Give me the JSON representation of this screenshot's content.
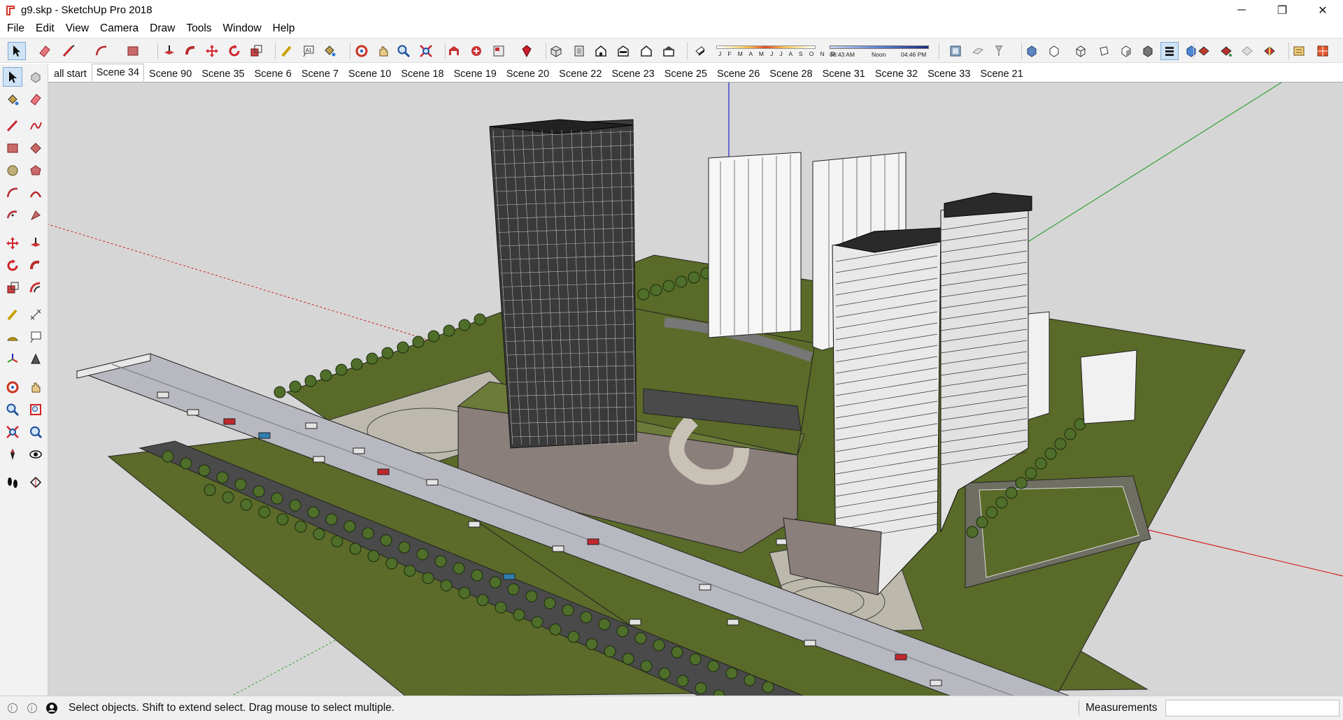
{
  "window": {
    "title": "g9.skp - SketchUp Pro 2018",
    "controls": {
      "minimize": "─",
      "maximize": "❐",
      "close": "✕"
    }
  },
  "menu": [
    "File",
    "Edit",
    "View",
    "Camera",
    "Draw",
    "Tools",
    "Window",
    "Help"
  ],
  "toolbar": {
    "icons": [
      "select-icon",
      "eraser-icon",
      "line-icon",
      "arc-icon",
      "rectangle-icon",
      "push-pull-icon",
      "follow-me-icon",
      "move-icon",
      "rotate-icon",
      "scale-icon",
      "tape-measure-icon",
      "text-icon",
      "paint-bucket-icon",
      "orbit-icon",
      "pan-icon",
      "zoom-icon",
      "zoom-extents-icon",
      "warehouse-icon",
      "extension-warehouse-icon",
      "layout-icon",
      "ruby-icon",
      "iso-view-icon",
      "top-view-icon",
      "front-view-icon",
      "right-view-icon",
      "back-view-icon",
      "left-view-icon",
      "shadows-toggle-icon"
    ],
    "shadow": {
      "months": "J F M A M J J A S O N D",
      "time_start": "06:43 AM",
      "time_mid": "Noon",
      "time_end": "04:46 PM"
    },
    "right_icons": [
      "model-info-icon",
      "section-plane-icon",
      "section-display-icon",
      "xray-style-icon",
      "backedges-style-icon",
      "wireframe-style-icon",
      "hidden-line-style-icon",
      "shaded-style-icon",
      "shaded-textures-icon",
      "monochrome-style-icon",
      "match-photo-icon",
      "components-icon",
      "materials-icon",
      "styles-icon",
      "layers-icon",
      "scenes-icon"
    ]
  },
  "scenes": {
    "active": "Scene 34",
    "tabs": [
      "all start",
      "Scene 34",
      "Scene 90",
      "Scene 35",
      "Scene 6",
      "Scene 7",
      "Scene 10",
      "Scene 18",
      "Scene 19",
      "Scene 20",
      "Scene 22",
      "Scene 23",
      "Scene 25",
      "Scene 26",
      "Scene 28",
      "Scene 31",
      "Scene 32",
      "Scene 33",
      "Scene 21"
    ]
  },
  "left_tools": [
    [
      "select-icon",
      "make-component-icon"
    ],
    [
      "paint-bucket-icon",
      "eraser-icon"
    ],
    [
      "line-icon",
      "freehand-icon"
    ],
    [
      "rectangle-icon",
      "rotated-rectangle-icon"
    ],
    [
      "circle-icon",
      "polygon-icon"
    ],
    [
      "arc-icon",
      "two-point-arc-icon"
    ],
    [
      "three-point-arc-icon",
      "pie-icon"
    ],
    [
      "move-icon",
      "push-pull-icon"
    ],
    [
      "rotate-icon",
      "follow-me-icon"
    ],
    [
      "scale-icon",
      "offset-icon"
    ],
    [
      "tape-measure-icon",
      "dimension-icon"
    ],
    [
      "protractor-icon",
      "text-icon"
    ],
    [
      "axes-icon",
      "3d-text-icon"
    ],
    [
      "orbit-icon",
      "pan-icon"
    ],
    [
      "zoom-icon",
      "zoom-window-icon"
    ],
    [
      "zoom-extents-icon",
      "previous-view-icon"
    ],
    [
      "position-camera-icon",
      "look-around-icon"
    ],
    [
      "walk-icon",
      "section-plane-icon"
    ]
  ],
  "status": {
    "message": "Select objects. Shift to extend select. Drag mouse to select multiple.",
    "measurements_label": "Measurements",
    "measurements_value": ""
  },
  "colors": {
    "viewport_bg": "#d6d6d6",
    "ground": "#5c6a2a",
    "axis_red": "#d02020",
    "axis_green": "#30a030",
    "axis_blue": "#2020d0",
    "accent_select": "#cfe3f5"
  }
}
